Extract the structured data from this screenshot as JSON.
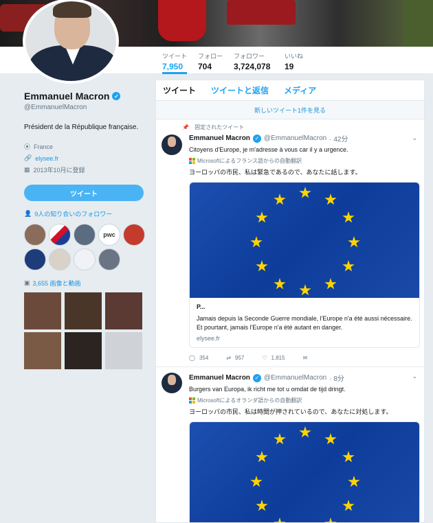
{
  "header": {
    "stats": [
      {
        "label": "ツイート",
        "value": "7,950"
      },
      {
        "label": "フォロー",
        "value": "704"
      },
      {
        "label": "フォロワー",
        "value": "3,724,078"
      },
      {
        "label": "いいね",
        "value": "19"
      }
    ]
  },
  "profile": {
    "name": "Emmanuel Macron",
    "handle": "@EmmanuelMacron",
    "bio": "Président de la République française.",
    "location": "France",
    "website": "elysee.fr",
    "joined": "2013年10月に登録",
    "tweet_button": "ツイート",
    "followers_you_know": "9人の知り合いのフォロワー",
    "media_count": "3,655 画像と動画"
  },
  "timeline": {
    "tabs": [
      "ツイート",
      "ツイートと返信",
      "メディア"
    ],
    "new_tweets": "新しいツイート1件を見る",
    "tweets": [
      {
        "pinned": "固定されたツイート",
        "name": "Emmanuel Macron",
        "handle": "@EmmanuelMacron",
        "time": "· 42分",
        "text": "Citoyens d'Europe, je m'adresse à vous car il y a urgence.",
        "translated": "Microsoftによるフランス語からの自動翻訳",
        "translation": "ヨーロッパの市民、私は緊急であるので、あなたに話します。",
        "card_title": "P...",
        "card_desc": "Jamais depuis la Seconde Guerre mondiale, l'Europe n'a été aussi nécessaire. Et pourtant, jamais l'Europe n'a été autant en danger.",
        "card_url": "elysee.fr",
        "replies": "354",
        "retweets": "957",
        "likes": "1,815"
      },
      {
        "name": "Emmanuel Macron",
        "handle": "@EmmanuelMacron",
        "time": "· 8分",
        "text": "Burgers van Europa, ik richt me tot u omdat de tijd dringt.",
        "translated": "Microsoftによるオランダ語からの自動翻訳",
        "translation": "ヨーロッパの市民、私は時間が押されているので、あなたに対処します。"
      }
    ]
  },
  "colors": {
    "accent": "#1da1f2",
    "button": "#4ab3f4",
    "background": "#e6ecf0",
    "eu_blue": "#0d3c9a",
    "eu_gold": "#ffd400"
  }
}
